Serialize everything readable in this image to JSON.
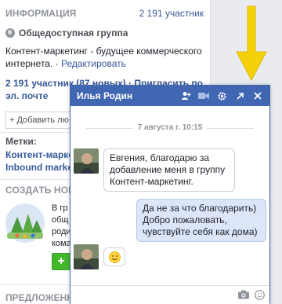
{
  "sidebar": {
    "info_heading": "ИНФОРМАЦИЯ",
    "members_count_link": "2 191 участник",
    "group_type": "Общедоступная группа",
    "description": "Контент-маркетинг - будущее коммерческого интернета.",
    "edit_link": "Редактировать",
    "members_line": "2 191 участник (87 новых) · Пригласить по эл. почте",
    "add_placeholder": "+ Добавить лю",
    "tags_heading": "Метки:",
    "tags": [
      "Контент-марке",
      "Inbound marke"
    ],
    "create_heading": "СОЗДАТЬ НОВ",
    "promo_text": "В гр общ роди кома",
    "add_button": "+",
    "suggestions_heading": "ПРЕДЛОЖЕННЫ"
  },
  "chat": {
    "title": "Илья Родин",
    "header_icons": [
      "add-friend-icon",
      "video-call-icon",
      "settings-gear-icon",
      "popout-icon",
      "close-icon"
    ],
    "date_separator": "7 августа г. 10:15",
    "messages": [
      {
        "direction": "in",
        "text": "Евгения, благодарю за добавление меня в группу Контент-маркетинг."
      },
      {
        "direction": "out",
        "text": "Да не за что благодарить) Добро пожаловать, чувствуйте себя как дома)"
      },
      {
        "direction": "in",
        "text": "☺"
      }
    ]
  },
  "colors": {
    "chat_header": "#4267b2",
    "link": "#365899",
    "arrow": "#f5d10a",
    "green_button": "#42b72a"
  }
}
